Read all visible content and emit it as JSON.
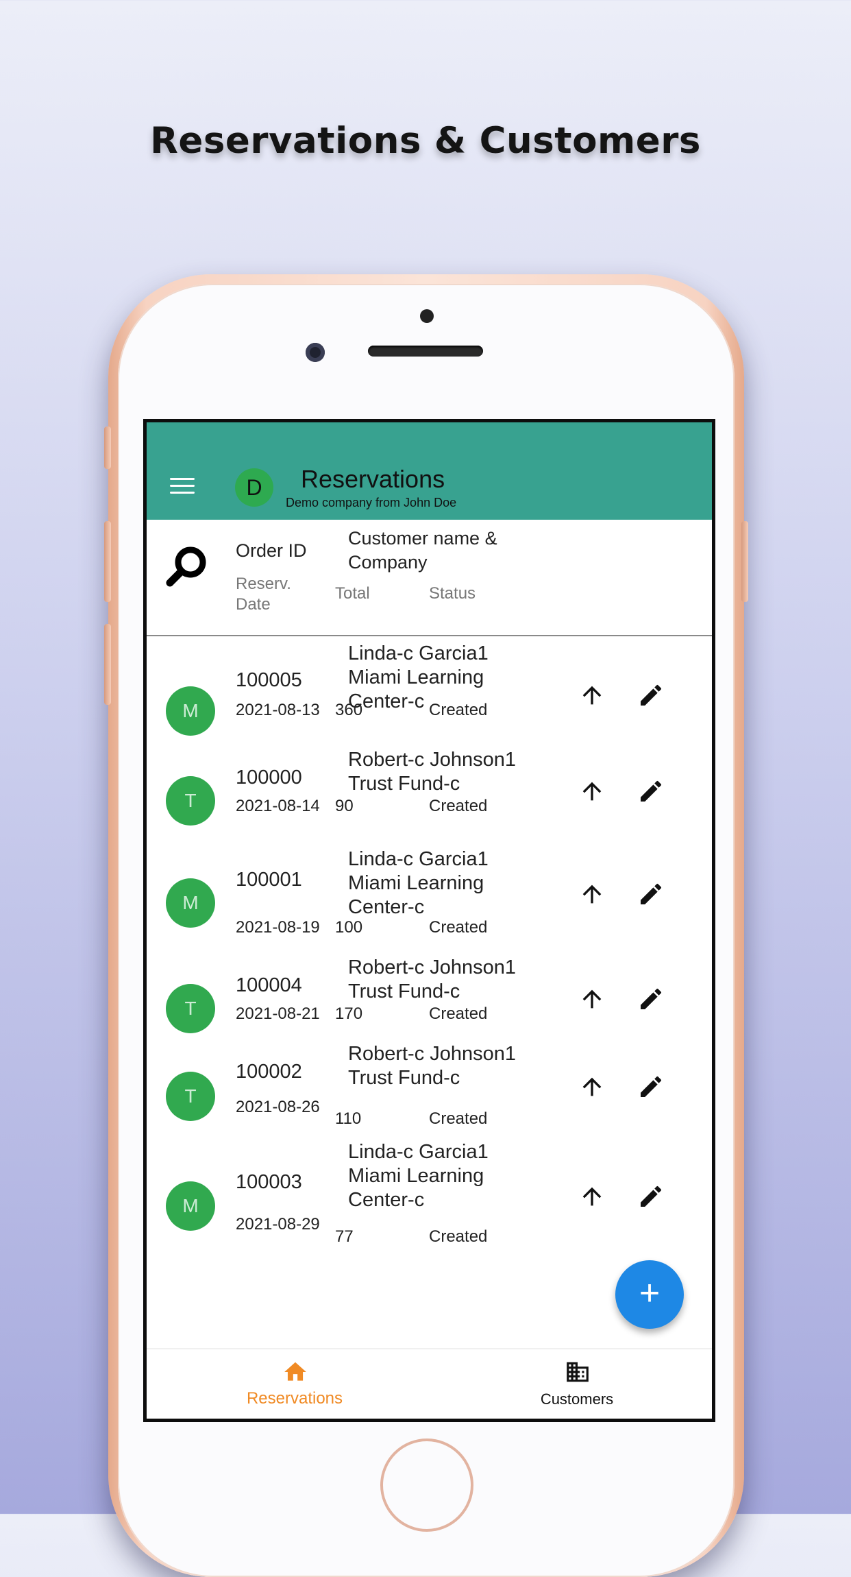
{
  "headline": "Reservations & Customers",
  "appbar": {
    "avatar_letter": "D",
    "title": "Reservations",
    "subtitle": "Demo company from John Doe"
  },
  "list_header": {
    "order_id": "Order ID",
    "customer": "Customer name & Company",
    "date": "Reserv. Date",
    "total": "Total",
    "status": "Status"
  },
  "reservations": [
    {
      "initial": "M",
      "order_id": "100005",
      "customer": "Linda-c Garcia1 Miami Learning Center-c",
      "date": "2021-08-13",
      "total": "360",
      "status": "Created"
    },
    {
      "initial": "T",
      "order_id": "100000",
      "customer": "Robert-c Johnson1 Trust Fund-c",
      "date": "2021-08-14",
      "total": "90",
      "status": "Created"
    },
    {
      "initial": "M",
      "order_id": "100001",
      "customer": "Linda-c Garcia1 Miami Learning Center-c",
      "date": "2021-08-19",
      "total": "100",
      "status": "Created"
    },
    {
      "initial": "T",
      "order_id": "100004",
      "customer": "Robert-c Johnson1 Trust Fund-c",
      "date": "2021-08-21",
      "total": "170",
      "status": "Created"
    },
    {
      "initial": "T",
      "order_id": "100002",
      "customer": "Robert-c Johnson1 Trust Fund-c",
      "date": "2021-08-26",
      "total": "110",
      "status": "Created"
    },
    {
      "initial": "M",
      "order_id": "100003",
      "customer": "Linda-c Garcia1 Miami Learning Center-c",
      "date": "2021-08-29",
      "total": "77",
      "status": "Created"
    }
  ],
  "fab_label": "+",
  "bottom_nav": [
    {
      "label": "Reservations",
      "icon": "home-icon",
      "active": true
    },
    {
      "label": "Customers",
      "icon": "building-icon",
      "active": false
    }
  ],
  "colors": {
    "appbar": "#38a290",
    "avatar": "#31a94f",
    "fab": "#1e88e5",
    "active_nav": "#f08a24"
  }
}
